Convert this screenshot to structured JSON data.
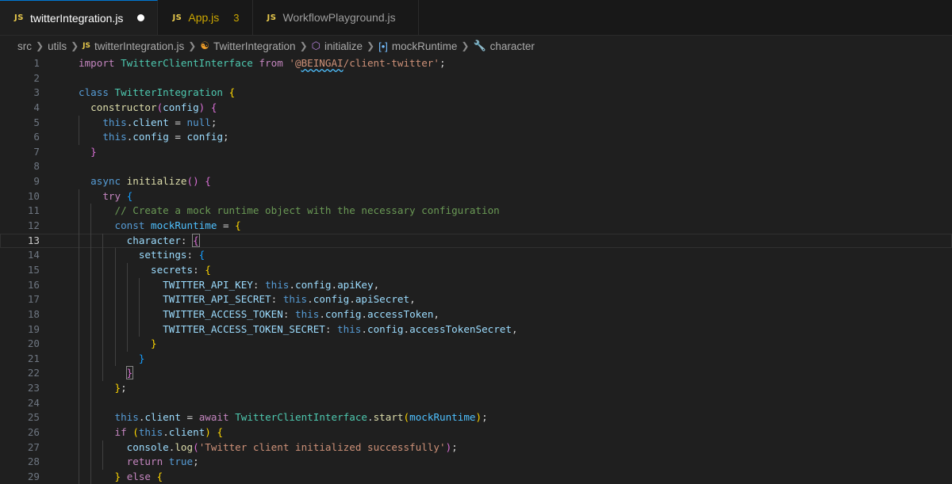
{
  "tabs": [
    {
      "icon_label": "JS",
      "label": "twitterIntegration.js",
      "active": true,
      "dirty": true
    },
    {
      "icon_label": "JS",
      "label": "App.js",
      "badge": "3"
    },
    {
      "icon_label": "JS",
      "label": "WorkflowPlayground.js"
    }
  ],
  "breadcrumb": {
    "src": "src",
    "utils": "utils",
    "file_icon": "JS",
    "file": "twitterIntegration.js",
    "class": "TwitterIntegration",
    "method": "initialize",
    "variable": "mockRuntime",
    "property": "character"
  },
  "editor": {
    "current_line": 13,
    "line_numbers": [
      "1",
      "2",
      "3",
      "4",
      "5",
      "6",
      "7",
      "8",
      "9",
      "10",
      "11",
      "12",
      "13",
      "14",
      "15",
      "16",
      "17",
      "18",
      "19",
      "20",
      "21",
      "22",
      "23",
      "24",
      "25",
      "26",
      "27",
      "28",
      "29"
    ],
    "lines": [
      [
        [
          "kw2",
          "import "
        ],
        [
          "cls",
          "TwitterClientInterface "
        ],
        [
          "kw2",
          "from "
        ],
        [
          "str",
          "'@"
        ],
        [
          "str sq",
          "BEINGAI"
        ],
        [
          "str",
          "/client-twitter'"
        ],
        [
          "pl",
          ";"
        ]
      ],
      [],
      [
        [
          "kw",
          "class "
        ],
        [
          "cls",
          "TwitterIntegration "
        ],
        [
          "b1",
          "{"
        ]
      ],
      [
        [
          "fn",
          "constructor"
        ],
        [
          "b2",
          "("
        ],
        [
          "var",
          "config"
        ],
        [
          "b2",
          ")"
        ],
        [
          "pl",
          " "
        ],
        [
          "b2",
          "{"
        ]
      ],
      [
        [
          "kw",
          "this"
        ],
        [
          "pl",
          "."
        ],
        [
          "var",
          "client"
        ],
        [
          "pl",
          " = "
        ],
        [
          "kw",
          "null"
        ],
        [
          "pl",
          ";"
        ]
      ],
      [
        [
          "kw",
          "this"
        ],
        [
          "pl",
          "."
        ],
        [
          "var",
          "config"
        ],
        [
          "pl",
          " = "
        ],
        [
          "var",
          "config"
        ],
        [
          "pl",
          ";"
        ]
      ],
      [
        [
          "b2",
          "}"
        ]
      ],
      [],
      [
        [
          "kw",
          "async "
        ],
        [
          "fn",
          "initialize"
        ],
        [
          "b2",
          "()"
        ],
        [
          "pl",
          " "
        ],
        [
          "b2",
          "{"
        ]
      ],
      [
        [
          "kw2",
          "try "
        ],
        [
          "b3",
          "{"
        ]
      ],
      [
        [
          "cm",
          "// Create a mock runtime object with the necessary configuration"
        ]
      ],
      [
        [
          "kw",
          "const "
        ],
        [
          "cst",
          "mockRuntime"
        ],
        [
          "pl",
          " = "
        ],
        [
          "b1",
          "{"
        ]
      ],
      [
        [
          "var",
          "character"
        ],
        [
          "pl",
          ": "
        ],
        [
          "b2 bm",
          "{"
        ]
      ],
      [
        [
          "var",
          "settings"
        ],
        [
          "pl",
          ": "
        ],
        [
          "b3",
          "{"
        ]
      ],
      [
        [
          "var",
          "secrets"
        ],
        [
          "pl",
          ": "
        ],
        [
          "b1",
          "{"
        ]
      ],
      [
        [
          "var",
          "TWITTER_API_KEY"
        ],
        [
          "pl",
          ": "
        ],
        [
          "kw",
          "this"
        ],
        [
          "pl",
          "."
        ],
        [
          "var",
          "config"
        ],
        [
          "pl",
          "."
        ],
        [
          "var",
          "apiKey"
        ],
        [
          "pl",
          ","
        ]
      ],
      [
        [
          "var",
          "TWITTER_API_SECRET"
        ],
        [
          "pl",
          ": "
        ],
        [
          "kw",
          "this"
        ],
        [
          "pl",
          "."
        ],
        [
          "var",
          "config"
        ],
        [
          "pl",
          "."
        ],
        [
          "var",
          "apiSecret"
        ],
        [
          "pl",
          ","
        ]
      ],
      [
        [
          "var",
          "TWITTER_ACCESS_TOKEN"
        ],
        [
          "pl",
          ": "
        ],
        [
          "kw",
          "this"
        ],
        [
          "pl",
          "."
        ],
        [
          "var",
          "config"
        ],
        [
          "pl",
          "."
        ],
        [
          "var",
          "accessToken"
        ],
        [
          "pl",
          ","
        ]
      ],
      [
        [
          "var",
          "TWITTER_ACCESS_TOKEN_SECRET"
        ],
        [
          "pl",
          ": "
        ],
        [
          "kw",
          "this"
        ],
        [
          "pl",
          "."
        ],
        [
          "var",
          "config"
        ],
        [
          "pl",
          "."
        ],
        [
          "var",
          "accessTokenSecret"
        ],
        [
          "pl",
          ","
        ]
      ],
      [
        [
          "b1",
          "}"
        ]
      ],
      [
        [
          "b3",
          "}"
        ]
      ],
      [
        [
          "b2 bm",
          "}"
        ]
      ],
      [
        [
          "b1",
          "}"
        ],
        [
          "pl",
          ";"
        ]
      ],
      [],
      [
        [
          "kw",
          "this"
        ],
        [
          "pl",
          "."
        ],
        [
          "var",
          "client"
        ],
        [
          "pl",
          " = "
        ],
        [
          "kw2",
          "await "
        ],
        [
          "cls",
          "TwitterClientInterface"
        ],
        [
          "pl",
          "."
        ],
        [
          "fn",
          "start"
        ],
        [
          "b1",
          "("
        ],
        [
          "cst",
          "mockRuntime"
        ],
        [
          "b1",
          ")"
        ],
        [
          "pl",
          ";"
        ]
      ],
      [
        [
          "kw2",
          "if "
        ],
        [
          "b1",
          "("
        ],
        [
          "kw",
          "this"
        ],
        [
          "pl",
          "."
        ],
        [
          "var",
          "client"
        ],
        [
          "b1",
          ")"
        ],
        [
          "pl",
          " "
        ],
        [
          "b1",
          "{"
        ]
      ],
      [
        [
          "var",
          "console"
        ],
        [
          "pl",
          "."
        ],
        [
          "fn",
          "log"
        ],
        [
          "b2",
          "("
        ],
        [
          "str",
          "'Twitter client initialized successfully'"
        ],
        [
          "b2",
          ")"
        ],
        [
          "pl",
          ";"
        ]
      ],
      [
        [
          "kw2",
          "return "
        ],
        [
          "kw",
          "true"
        ],
        [
          "pl",
          ";"
        ]
      ],
      [
        [
          "b1",
          "}"
        ],
        [
          "pl",
          " "
        ],
        [
          "kw2",
          "else "
        ],
        [
          "b1",
          "{"
        ]
      ]
    ]
  }
}
